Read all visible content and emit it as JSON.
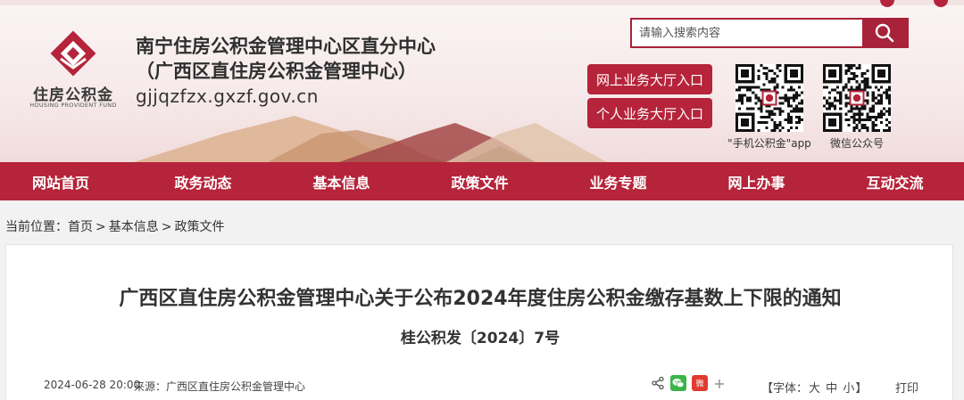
{
  "header": {
    "logo": {
      "name": "住房公积金",
      "en": "HOUSING PROVIDENT FUND"
    },
    "title_line1": "南宁住房公积金管理中心区直分中心",
    "title_line2": "（广西区直住房公积金管理中心）",
    "url": "gjjqzfzx.gxzf.gov.cn",
    "search": {
      "placeholder": "请输入搜索内容"
    },
    "portal_buttons": [
      "网上业务大厅入口",
      "个人业务大厅入口"
    ],
    "qr_codes": [
      {
        "label": "\"手机公积金\"app"
      },
      {
        "label": "微信公众号"
      }
    ]
  },
  "nav": {
    "items": [
      "网站首页",
      "政务动态",
      "基本信息",
      "政策文件",
      "业务专题",
      "网上办事",
      "互动交流"
    ]
  },
  "breadcrumb": {
    "prefix": "当前位置：",
    "items": [
      "首页",
      "基本信息",
      "政策文件"
    ],
    "separator": ">"
  },
  "article": {
    "title": "广西区直住房公积金管理中心关于公布2024年度住房公积金缴存基数上下限的通知",
    "doc_number": "桂公积发〔2024〕7号",
    "date": "2024-06-28 20:00",
    "source_label": "来源：",
    "source": "广西区直住房公积金管理中心",
    "share_icons": [
      "share-icon",
      "wechat-icon",
      "weibo-icon",
      "plus-icon"
    ],
    "weibo_text": "微",
    "font_control": {
      "label_open": "【字体：",
      "sizes": [
        "大",
        "中",
        "小"
      ],
      "label_close": "】"
    },
    "print_label": "打印"
  },
  "colors": {
    "brand_red": "#b5243a",
    "search_border": "#a8223a",
    "wechat_green": "#3bb54a"
  }
}
